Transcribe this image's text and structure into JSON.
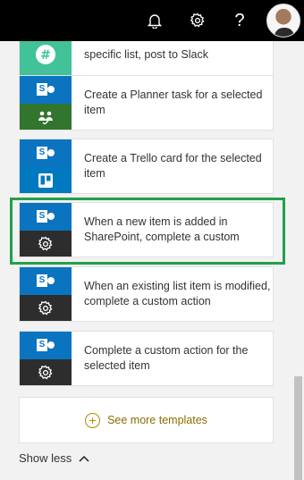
{
  "topbar": {
    "help_label": "?"
  },
  "templates": [
    {
      "text": "specific list, post to Slack",
      "bottom_icon": "slack-icon",
      "bottom_color": "#42c299"
    },
    {
      "text": "Create a Planner task for a selected item",
      "bottom_icon": "planner-icon",
      "bottom_color": "#31752f"
    },
    {
      "text": "Create a Trello card for the selected item",
      "bottom_icon": "trello-icon",
      "bottom_color": "#0079bf"
    },
    {
      "text": "When a new item is added in SharePoint, complete a custom",
      "bottom_icon": "custom-action-gear-icon",
      "bottom_color": "#2d2d2d"
    },
    {
      "text": "When an existing list item is modified, complete a custom action",
      "bottom_icon": "custom-action-gear-icon",
      "bottom_color": "#2d2d2d"
    },
    {
      "text": "Complete a custom action for the selected item",
      "bottom_icon": "custom-action-gear-icon",
      "bottom_color": "#2d2d2d"
    }
  ],
  "sharepoint_letter": "S",
  "see_more_label": "See more templates",
  "show_less_label": "Show less",
  "colors": {
    "sharepoint_blue": "#0a74c1",
    "highlight_green": "#21a04a",
    "link_gold": "#8a6e00"
  }
}
